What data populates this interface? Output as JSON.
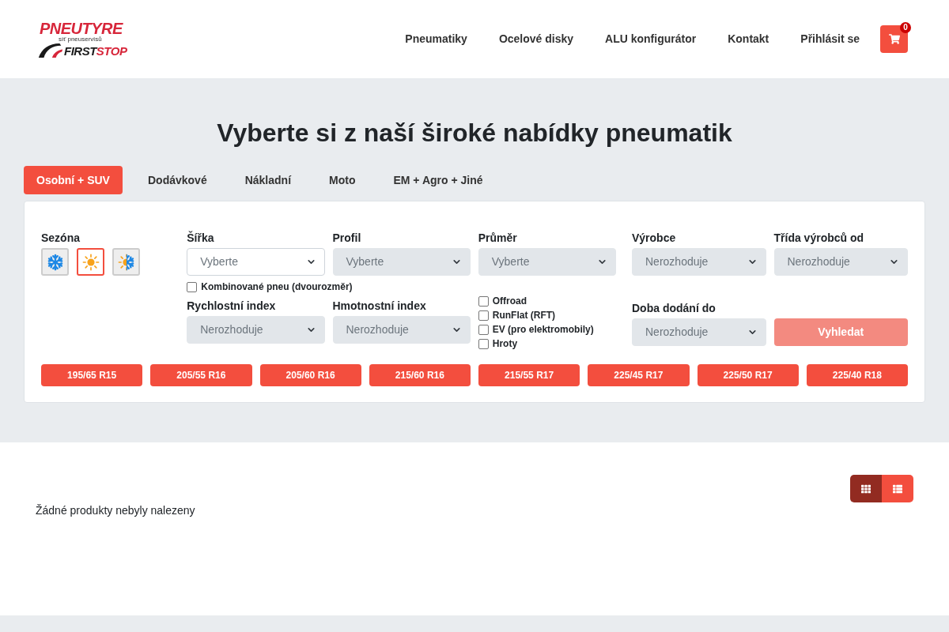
{
  "header": {
    "logo": {
      "wordmark": "PNEUTYRE",
      "tagline": "síť pneuservisů",
      "brand_first": "FIRST",
      "brand_second": "STOP"
    },
    "nav": [
      "Pneumatiky",
      "Ocelové disky",
      "ALU konfigurátor",
      "Kontakt",
      "Přihlásit se"
    ],
    "cart": {
      "count": "0"
    }
  },
  "search": {
    "title": "Vyberte si z naší široké nabídky pneumatik",
    "tabs": [
      {
        "label": "Osobní + SUV",
        "selected": true
      },
      {
        "label": "Dodávkové",
        "selected": false
      },
      {
        "label": "Nákladní",
        "selected": false
      },
      {
        "label": "Moto",
        "selected": false
      },
      {
        "label": "EM + Agro + Jiné",
        "selected": false
      }
    ],
    "season": {
      "label": "Sezóna",
      "options": [
        {
          "kind": "winter",
          "selected": false
        },
        {
          "kind": "summer",
          "selected": true
        },
        {
          "kind": "all_season",
          "selected": false
        }
      ]
    },
    "width": {
      "label": "Šířka",
      "value": "Vyberte",
      "disabled": false
    },
    "profile": {
      "label": "Profil",
      "value": "Vyberte",
      "disabled": true
    },
    "diameter": {
      "label": "Průměr",
      "value": "Vyberte",
      "disabled": true
    },
    "combined": {
      "label": "Kombinované pneu (dvourozměr)",
      "checked": false
    },
    "speed_index": {
      "label": "Rychlostní index",
      "value": "Nerozhoduje",
      "disabled": true
    },
    "load_index": {
      "label": "Hmotnostní index",
      "value": "Nerozhoduje",
      "disabled": true
    },
    "features": [
      {
        "label": "Offroad",
        "checked": false
      },
      {
        "label": "RunFlat (RFT)",
        "checked": false
      },
      {
        "label": "EV (pro elektromobily)",
        "checked": false
      },
      {
        "label": "Hroty",
        "checked": false
      }
    ],
    "manufacturer": {
      "label": "Výrobce",
      "value": "Nerozhoduje",
      "disabled": true
    },
    "manufacturer_class": {
      "label": "Třída výrobců od",
      "value": "Nerozhoduje",
      "disabled": true
    },
    "delivery": {
      "label": "Doba dodání do",
      "value": "Nerozhoduje",
      "disabled": true
    },
    "submit": {
      "label": "Vyhledat",
      "disabled": true
    },
    "quick_sizes": [
      "195/65 R15",
      "205/55 R16",
      "205/60 R16",
      "215/60 R16",
      "215/55 R17",
      "225/45 R17",
      "225/50 R17",
      "225/40 R18"
    ]
  },
  "results": {
    "view_toggle": [
      {
        "kind": "grid",
        "selected": true
      },
      {
        "kind": "list",
        "selected": false
      }
    ],
    "empty_message": "Žádné produkty nebyly nalezeny"
  }
}
